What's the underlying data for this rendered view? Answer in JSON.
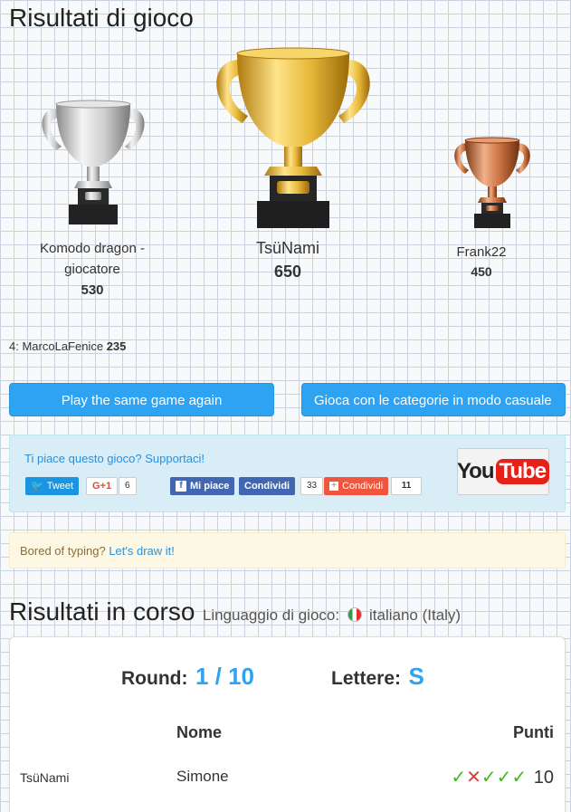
{
  "page_title": "Risultati di gioco",
  "podium": {
    "second": {
      "name": "Komodo dragon - giocatore",
      "score": "530"
    },
    "first": {
      "name": "TsüNami",
      "score": "650"
    },
    "third": {
      "name": "Frank22",
      "score": "450"
    }
  },
  "fourth": {
    "rank": "4:",
    "name": "MarcoLaFenice",
    "score": "235"
  },
  "buttons": {
    "play_again": "Play the same game again",
    "casual": "Gioca con le categorie in modo casuale"
  },
  "support": {
    "text": "Ti piace questo gioco? Supportaci!",
    "tweet": "Tweet",
    "gplus": "G+1",
    "gplus_count": "6",
    "like": "Mi piace",
    "share": "Condividi",
    "share_count": "33",
    "condividi2": "Condividi",
    "condividi2_count": "11",
    "youtube_you": "You",
    "youtube_tube": "Tube"
  },
  "draw": {
    "text": "Bored of typing?",
    "link": "Let's draw it!"
  },
  "running": {
    "title": "Risultati in corso",
    "lang_label": "Linguaggio di gioco:",
    "lang_value": "italiano (Italy)",
    "round_label": "Round:",
    "round_value": "1 / 10",
    "letter_label": "Lettere:",
    "letter_value": "S",
    "col_name": "Nome",
    "col_points": "Punti",
    "rows": [
      {
        "player": "TsüNami",
        "answer": "Simone",
        "marks": [
          "✓",
          "✕",
          "✓",
          "✓",
          "✓"
        ],
        "points": "10"
      }
    ]
  },
  "colors": {
    "accent": "#2ea3f2",
    "check": "#44b820",
    "cross": "#e23b3b"
  }
}
